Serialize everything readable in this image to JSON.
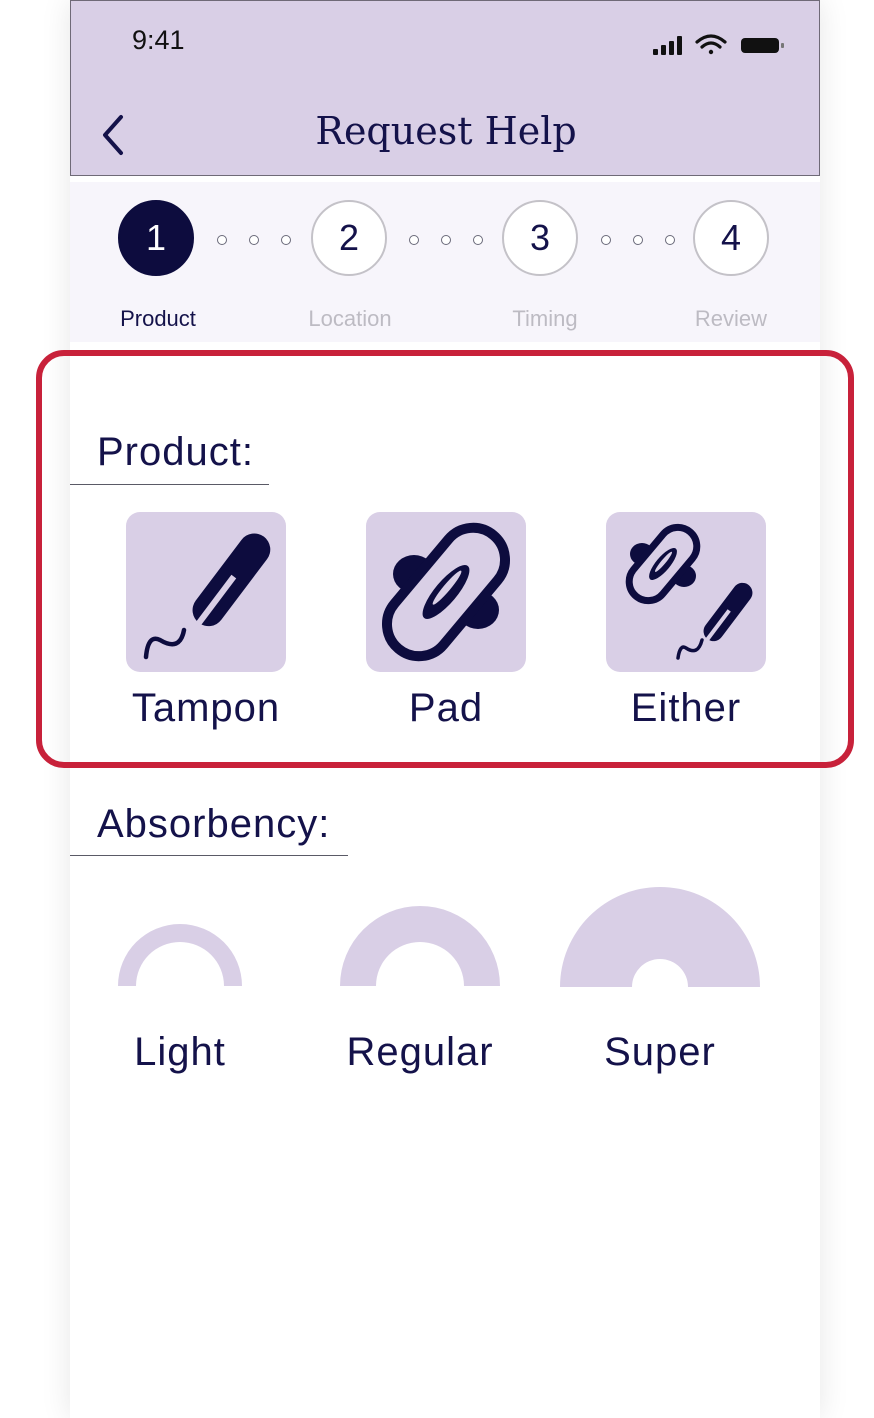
{
  "status_bar": {
    "time": "9:41"
  },
  "header": {
    "title": "Request Help"
  },
  "stepper": {
    "steps": [
      {
        "number": "1",
        "label": "Product"
      },
      {
        "number": "2",
        "label": "Location"
      },
      {
        "number": "3",
        "label": "Timing"
      },
      {
        "number": "4",
        "label": "Review"
      }
    ],
    "active_step": 1
  },
  "product_section": {
    "title": "Product:",
    "options": [
      {
        "label": "Tampon",
        "icon": "tampon-icon"
      },
      {
        "label": "Pad",
        "icon": "pad-icon"
      },
      {
        "label": "Either",
        "icon": "either-icon"
      }
    ]
  },
  "absorbency_section": {
    "title": "Absorbency:",
    "options": [
      {
        "label": "Light",
        "icon": "light-absorbency-icon"
      },
      {
        "label": "Regular",
        "icon": "regular-absorbency-icon"
      },
      {
        "label": "Super",
        "icon": "super-absorbency-icon"
      }
    ]
  },
  "colors": {
    "accent": "#d9cfe6",
    "navy": "#0d0c3e",
    "highlight_border": "#c8213a"
  }
}
